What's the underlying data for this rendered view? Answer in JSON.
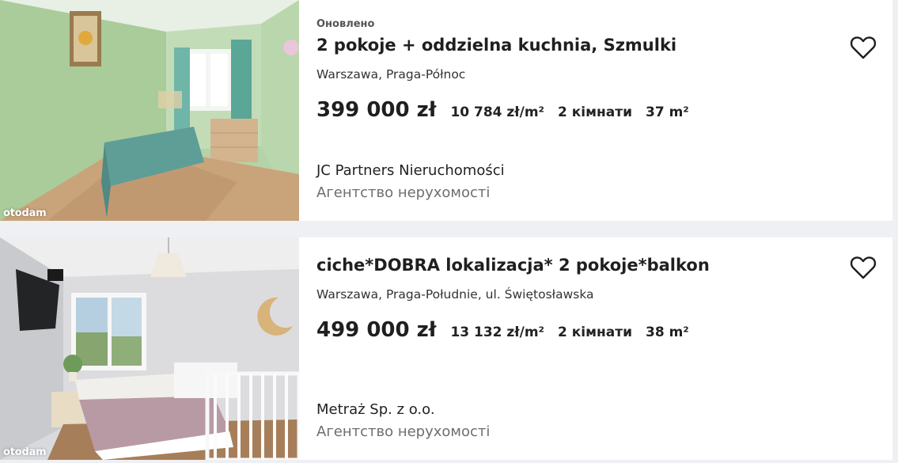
{
  "listings": [
    {
      "updated": "Оновлено",
      "title": "2 pokoje + oddzielna kuchnia, Szmulki",
      "location": "Warszawa, Praga-Północ",
      "price": "399 000 zł",
      "price_per_m2": "10 784 zł/m²",
      "rooms": "2 кімнати",
      "area": "37 m²",
      "agency_name": "JC Partners Nieruchomości",
      "agency_type": "Агентство нерухомості",
      "watermark": "otodam",
      "favorite_icon": "heart-outline-icon"
    },
    {
      "title": "ciche*DOBRA lokalizacja* 2 pokoje*balkon",
      "location": "Warszawa, Praga-Południe, ul. Świętosławska",
      "price": "499 000 zł",
      "price_per_m2": "13 132 zł/m²",
      "rooms": "2 кімнати",
      "area": "38 m²",
      "agency_name": "Metraż Sp. z o.o.",
      "agency_type": "Агентство нерухомості",
      "watermark": "otodam",
      "favorite_icon": "heart-outline-icon"
    }
  ],
  "colors": {
    "page_background": "#eff0f3",
    "card_background": "#ffffff",
    "text_primary": "#1f1f1f",
    "text_secondary": "#6e6e6e"
  }
}
